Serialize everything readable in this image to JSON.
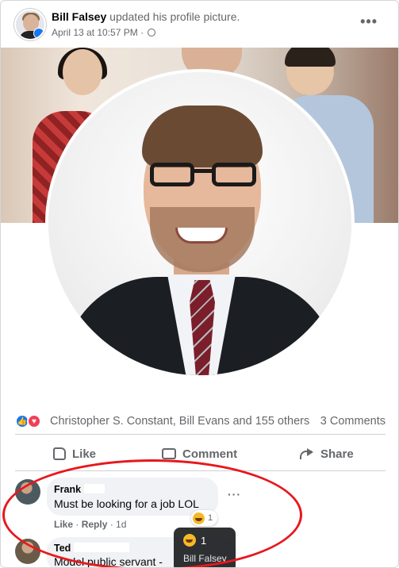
{
  "post": {
    "author": "Bill Falsey",
    "action": "updated his profile picture.",
    "timestamp": "April 13 at 10:57 PM",
    "separator": "·"
  },
  "reactions": {
    "names": "Christopher S. Constant, Bill Evans and 155 others",
    "comments_count": "3 Comments"
  },
  "actions": {
    "like_label": "Like",
    "comment_label": "Comment",
    "share_label": "Share"
  },
  "comments": [
    {
      "author": "Frank",
      "text": "Must be looking for a job LOL",
      "like_label": "Like",
      "reply_label": "Reply",
      "age": "1d",
      "reaction_count": "1"
    },
    {
      "author": "Ted",
      "text": "Model public servant -"
    }
  ],
  "tooltip": {
    "count": "1",
    "name": "Bill Falsey"
  },
  "colors": {
    "like": "#1877f2",
    "love": "#f33e58",
    "haha": "#f7b928",
    "annotation_oval": "#e8171d"
  },
  "icons": [
    "more-icon",
    "globe-icon",
    "like-reaction-icon",
    "love-reaction-icon",
    "thumbs-up-icon",
    "comment-icon",
    "share-icon",
    "haha-reaction-icon"
  ]
}
